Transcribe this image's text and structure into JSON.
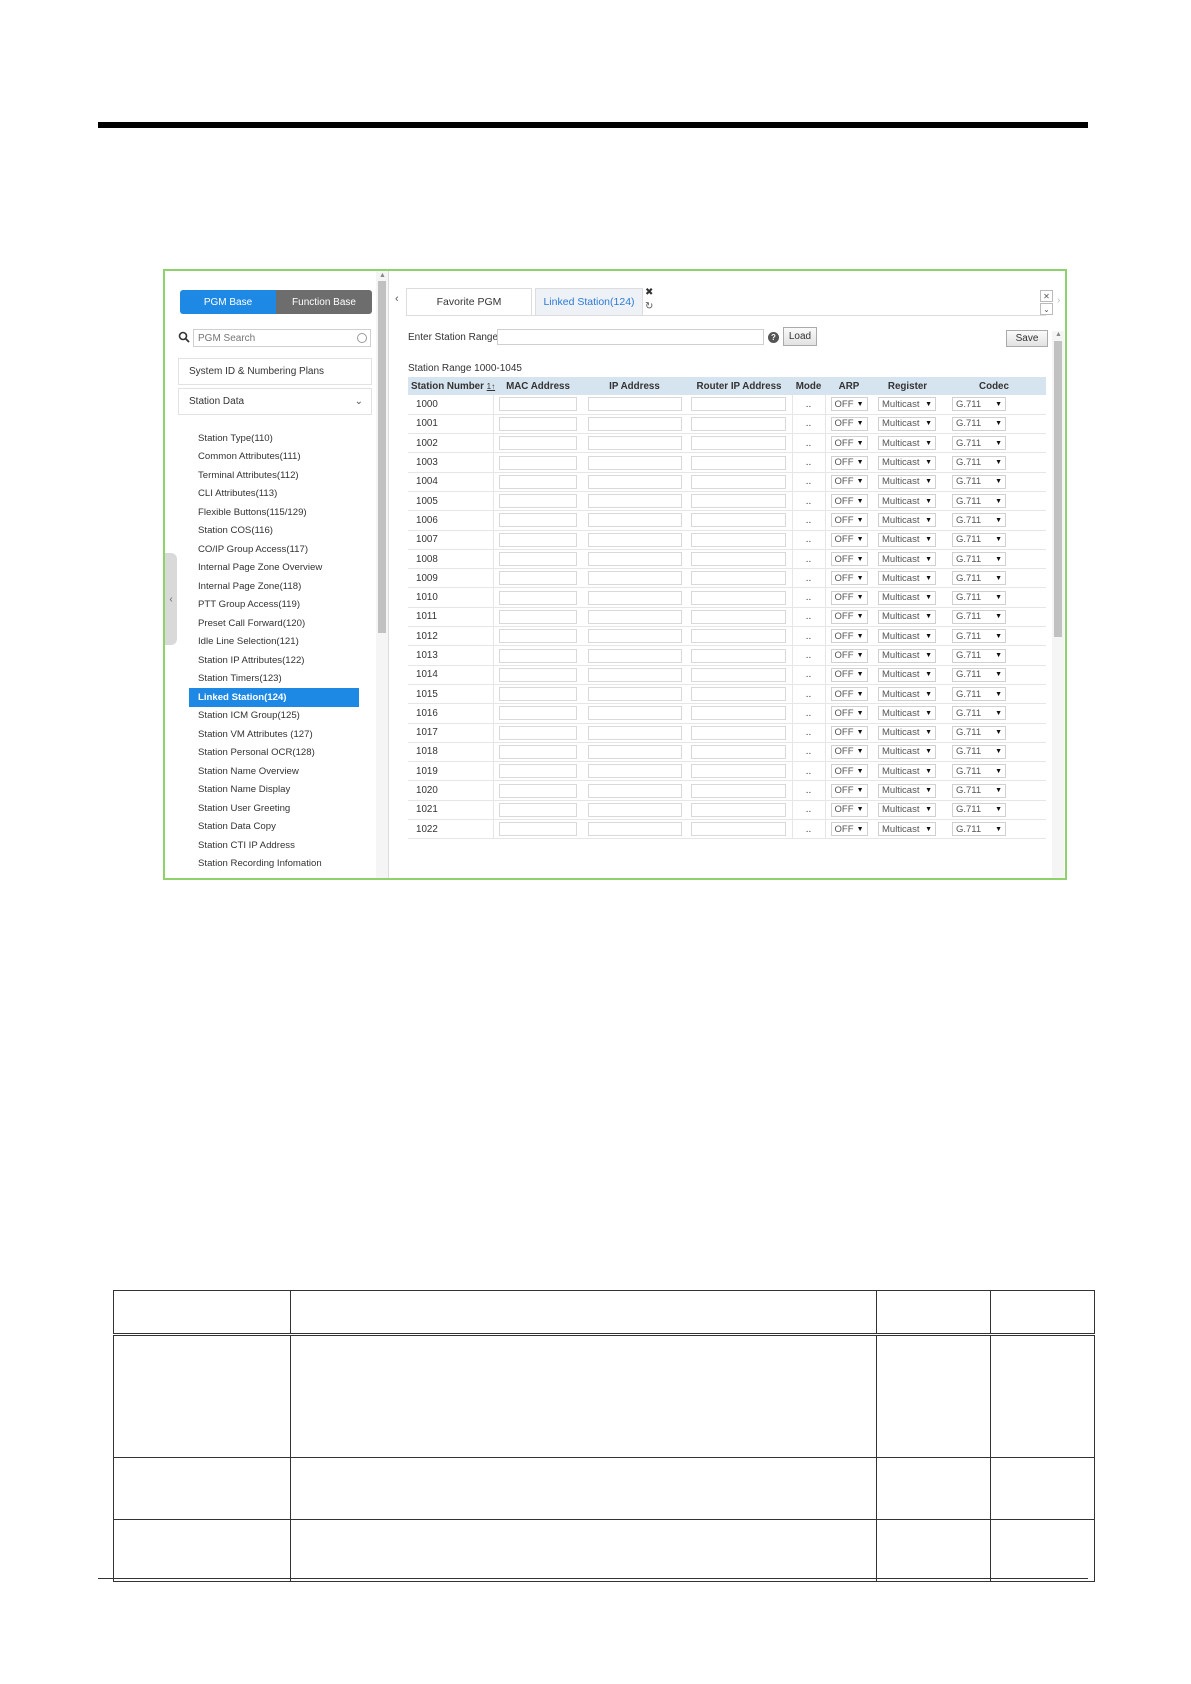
{
  "sidebar": {
    "segments": {
      "pgm_base": "PGM Base",
      "function_base": "Function Base"
    },
    "search_placeholder": "PGM Search",
    "menu": {
      "system_id": "System ID & Numbering Plans",
      "station_data": "Station Data"
    },
    "items": [
      "Station Type(110)",
      "Common Attributes(111)",
      "Terminal Attributes(112)",
      "CLI Attributes(113)",
      "Flexible Buttons(115/129)",
      "Station COS(116)",
      "CO/IP Group Access(117)",
      "Internal Page Zone Overview",
      "Internal Page Zone(118)",
      "PTT Group Access(119)",
      "Preset Call Forward(120)",
      "Idle Line Selection(121)",
      "Station IP Attributes(122)",
      "Station Timers(123)",
      "Linked Station(124)",
      "Station ICM Group(125)",
      "Station VM Attributes (127)",
      "Station Personal OCR(128)",
      "Station Name Overview",
      "Station Name Display",
      "Station User Greeting",
      "Station Data Copy",
      "Station CTI IP Address",
      "Station Recording Infomation"
    ],
    "active_item": "Linked Station(124)"
  },
  "tabs": {
    "favorite": "Favorite PGM",
    "linked": "Linked Station(124)"
  },
  "form": {
    "range_label": "Enter Station Range :",
    "load": "Load",
    "save": "Save",
    "range_text": "Station Range 1000-1045"
  },
  "table": {
    "headers": [
      "Station Number",
      "MAC Address",
      "IP Address",
      "Router IP Address",
      "Mode",
      "ARP",
      "Register",
      "Codec"
    ],
    "sort_marker": "1↑",
    "mode_placeholder": "..",
    "rows": [
      {
        "station": "1000",
        "arp": "OFF",
        "register": "Multicast",
        "codec": "G.711"
      },
      {
        "station": "1001",
        "arp": "OFF",
        "register": "Multicast",
        "codec": "G.711"
      },
      {
        "station": "1002",
        "arp": "OFF",
        "register": "Multicast",
        "codec": "G.711"
      },
      {
        "station": "1003",
        "arp": "OFF",
        "register": "Multicast",
        "codec": "G.711"
      },
      {
        "station": "1004",
        "arp": "OFF",
        "register": "Multicast",
        "codec": "G.711"
      },
      {
        "station": "1005",
        "arp": "OFF",
        "register": "Multicast",
        "codec": "G.711"
      },
      {
        "station": "1006",
        "arp": "OFF",
        "register": "Multicast",
        "codec": "G.711"
      },
      {
        "station": "1007",
        "arp": "OFF",
        "register": "Multicast",
        "codec": "G.711"
      },
      {
        "station": "1008",
        "arp": "OFF",
        "register": "Multicast",
        "codec": "G.711"
      },
      {
        "station": "1009",
        "arp": "OFF",
        "register": "Multicast",
        "codec": "G.711"
      },
      {
        "station": "1010",
        "arp": "OFF",
        "register": "Multicast",
        "codec": "G.711"
      },
      {
        "station": "1011",
        "arp": "OFF",
        "register": "Multicast",
        "codec": "G.711"
      },
      {
        "station": "1012",
        "arp": "OFF",
        "register": "Multicast",
        "codec": "G.711"
      },
      {
        "station": "1013",
        "arp": "OFF",
        "register": "Multicast",
        "codec": "G.711"
      },
      {
        "station": "1014",
        "arp": "OFF",
        "register": "Multicast",
        "codec": "G.711"
      },
      {
        "station": "1015",
        "arp": "OFF",
        "register": "Multicast",
        "codec": "G.711"
      },
      {
        "station": "1016",
        "arp": "OFF",
        "register": "Multicast",
        "codec": "G.711"
      },
      {
        "station": "1017",
        "arp": "OFF",
        "register": "Multicast",
        "codec": "G.711"
      },
      {
        "station": "1018",
        "arp": "OFF",
        "register": "Multicast",
        "codec": "G.711"
      },
      {
        "station": "1019",
        "arp": "OFF",
        "register": "Multicast",
        "codec": "G.711"
      },
      {
        "station": "1020",
        "arp": "OFF",
        "register": "Multicast",
        "codec": "G.711"
      },
      {
        "station": "1021",
        "arp": "OFF",
        "register": "Multicast",
        "codec": "G.711"
      },
      {
        "station": "1022",
        "arp": "OFF",
        "register": "Multicast",
        "codec": "G.711"
      }
    ]
  },
  "icons": {
    "search": "search-icon",
    "clear": "clear-icon",
    "chevron": "chevron-down-icon",
    "help": "help-icon",
    "close": "close-icon",
    "refresh": "refresh-icon"
  },
  "colors": {
    "accent": "#1e88e5",
    "frame": "#8fd16a",
    "header_bg": "#d6e4f0"
  }
}
